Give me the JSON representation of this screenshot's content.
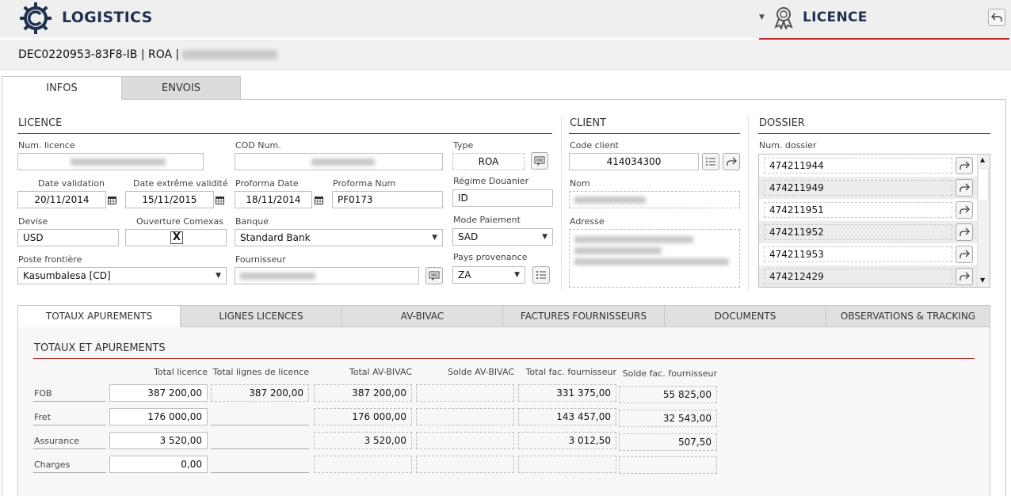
{
  "app": {
    "title": "LOGISTICS",
    "module_title": "LICENCE"
  },
  "record": {
    "id_line": "DEC0220953-83F8-IB | ROA |"
  },
  "top_tabs": [
    "INFOS",
    "ENVOIS"
  ],
  "licence": {
    "section_title": "LICENCE",
    "num_licence_label": "Num. licence",
    "cod_num_label": "COD Num.",
    "type_label": "Type",
    "type_value": "ROA",
    "date_validation_label": "Date validation",
    "date_validation_value": "20/11/2014",
    "date_extreme_label": "Date extrême validité",
    "date_extreme_value": "15/11/2015",
    "proforma_date_label": "Proforma Date",
    "proforma_date_value": "18/11/2014",
    "proforma_num_label": "Proforma Num",
    "proforma_num_value": "PF0173",
    "regime_label": "Régime Douanier",
    "regime_value": "ID",
    "devise_label": "Devise",
    "devise_value": "USD",
    "ouverture_label": "Ouverture Comexas",
    "ouverture_value": "X",
    "banque_label": "Banque",
    "banque_value": "Standard Bank",
    "mode_paiement_label": "Mode Paiement",
    "mode_paiement_value": "SAD",
    "poste_label": "Poste frontière",
    "poste_value": "Kasumbalesa [CD]",
    "fournisseur_label": "Fournisseur",
    "pays_label": "Pays provenance",
    "pays_value": "ZA"
  },
  "client": {
    "section_title": "CLIENT",
    "code_label": "Code client",
    "code_value": "414034300",
    "nom_label": "Nom",
    "adresse_label": "Adresse"
  },
  "dossier": {
    "section_title": "DOSSIER",
    "num_label": "Num. dossier",
    "items": [
      "474211944",
      "474211949",
      "474211951",
      "474211952",
      "474211953",
      "474212429"
    ]
  },
  "bottom_tabs": [
    "TOTAUX APUREMENTS",
    "LIGNES LICENCES",
    "AV-BIVAC",
    "FACTURES FOURNISSEURS",
    "DOCUMENTS",
    "OBSERVATIONS & TRACKING"
  ],
  "totaux": {
    "section_title": "TOTAUX ET APUREMENTS",
    "columns": [
      "Total licence",
      "Total lignes de licence",
      "Total AV-BIVAC",
      "Solde AV-BIVAC",
      "Total fac. fournisseur",
      "Solde fac. fournisseur"
    ],
    "rows": [
      {
        "label": "FOB",
        "values": [
          "387 200,00",
          "387 200,00",
          "387 200,00",
          "",
          "331 375,00",
          "55 825,00"
        ]
      },
      {
        "label": "Fret",
        "values": [
          "176 000,00",
          "",
          "176 000,00",
          "",
          "143 457,00",
          "32 543,00"
        ]
      },
      {
        "label": "Assurance",
        "values": [
          "3 520,00",
          "",
          "3 520,00",
          "",
          "3 012,50",
          "507,50"
        ]
      },
      {
        "label": "Charges",
        "values": [
          "0,00",
          "",
          "",
          "",
          "",
          ""
        ]
      }
    ]
  },
  "colors": {
    "accent": "#b52a2a",
    "brand": "#1f3050"
  }
}
